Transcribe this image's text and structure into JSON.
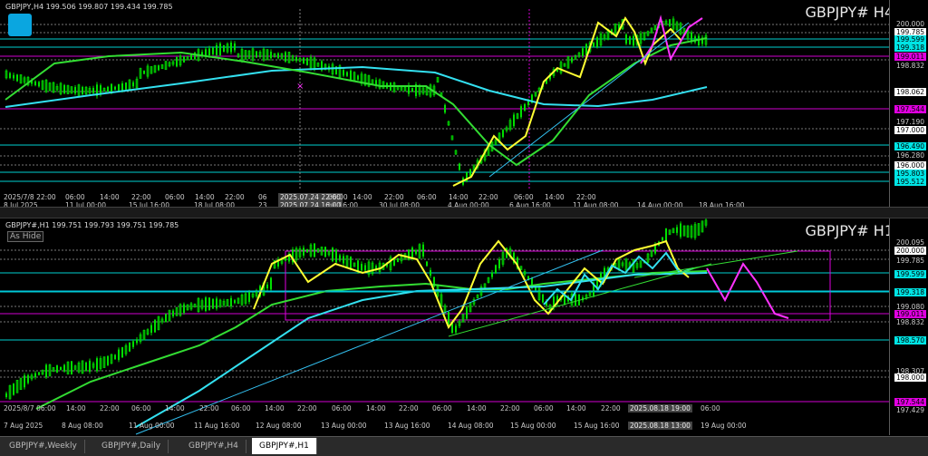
{
  "h4": {
    "header": "GBPJPY,H4  199.506 199.807 199.434 199.785",
    "symbol": "GBPJPY# H4",
    "price_labels": [
      {
        "text": "200.000",
        "style": "w"
      },
      {
        "text": "199.785",
        "style": "b"
      },
      {
        "text": "199.599",
        "style": "c"
      },
      {
        "text": "199.318",
        "style": "c"
      },
      {
        "text": "199.011",
        "style": "m"
      },
      {
        "text": "198.832",
        "style": "w"
      },
      {
        "text": "198.062",
        "style": "b"
      },
      {
        "text": "197.544",
        "style": "m"
      },
      {
        "text": "197.190",
        "style": "w"
      },
      {
        "text": "197.000",
        "style": "b"
      },
      {
        "text": "196.490",
        "style": "c"
      },
      {
        "text": "196.280",
        "style": "w"
      },
      {
        "text": "196.000",
        "style": "b"
      },
      {
        "text": "195.803",
        "style": "c"
      },
      {
        "text": "195.512",
        "style": "c"
      }
    ],
    "time_labels": [
      {
        "text": "2025/7/8 22:00",
        "style": ""
      },
      {
        "text": "06:00",
        "style": ""
      },
      {
        "text": "14:00",
        "style": ""
      },
      {
        "text": "22:00",
        "style": ""
      },
      {
        "text": "06:00",
        "style": ""
      },
      {
        "text": "14:00",
        "style": ""
      },
      {
        "text": "22:00",
        "style": ""
      },
      {
        "text": "06",
        "style": ""
      },
      {
        "text": "2025.07.24 22:00",
        "style": "hl"
      },
      {
        "text": "06:00",
        "style": ""
      },
      {
        "text": "14:00",
        "style": ""
      },
      {
        "text": "22:00",
        "style": ""
      },
      {
        "text": "06:00",
        "style": ""
      },
      {
        "text": "14:00",
        "style": ""
      },
      {
        "text": "22:00",
        "style": ""
      },
      {
        "text": "06:00",
        "style": ""
      },
      {
        "text": "14:00",
        "style": ""
      },
      {
        "text": "22:00",
        "style": ""
      }
    ],
    "date_labels": [
      {
        "text": "8 Jul 2025",
        "style": ""
      },
      {
        "text": "11 Jul 00:00",
        "style": ""
      },
      {
        "text": "15 Jul 16:00",
        "style": ""
      },
      {
        "text": "18 Jul 08:00",
        "style": ""
      },
      {
        "text": "23",
        "style": ""
      },
      {
        "text": "2025.07.24 16:00",
        "style": "hl"
      },
      {
        "text": "Jul 16:00",
        "style": ""
      },
      {
        "text": "30 Jul 08:00",
        "style": ""
      },
      {
        "text": "4 Aug 00:00",
        "style": ""
      },
      {
        "text": "6 Aug 16:00",
        "style": ""
      },
      {
        "text": "11 Aug 08:00",
        "style": ""
      },
      {
        "text": "14 Aug 00:00",
        "style": ""
      },
      {
        "text": "18 Aug 16:00",
        "style": ""
      }
    ]
  },
  "h1": {
    "header": "GBPJPY#,H1  199.751 199.793 199.751 199.785",
    "as_hide": "As Hide",
    "symbol": "GBPJPY# H1",
    "price_labels": [
      {
        "text": "200.095",
        "style": "w"
      },
      {
        "text": "200.000",
        "style": "b"
      },
      {
        "text": "199.785",
        "style": "w"
      },
      {
        "text": "199.599",
        "style": "c"
      },
      {
        "text": "199.318",
        "style": "c"
      },
      {
        "text": "199.080",
        "style": "w"
      },
      {
        "text": "199.011",
        "style": "m"
      },
      {
        "text": "198.832",
        "style": "w"
      },
      {
        "text": "198.570",
        "style": "c"
      },
      {
        "text": "198.307",
        "style": "w"
      },
      {
        "text": "198.000",
        "style": "b"
      },
      {
        "text": "197.544",
        "style": "m"
      },
      {
        "text": "197.429",
        "style": "w"
      }
    ],
    "time_labels": [
      {
        "text": "2025/8/7 06:00",
        "style": ""
      },
      {
        "text": "14:00",
        "style": ""
      },
      {
        "text": "22:00",
        "style": ""
      },
      {
        "text": "06:00",
        "style": ""
      },
      {
        "text": "14:00",
        "style": ""
      },
      {
        "text": "22:00",
        "style": ""
      },
      {
        "text": "06:00",
        "style": ""
      },
      {
        "text": "14:00",
        "style": ""
      },
      {
        "text": "22:00",
        "style": ""
      },
      {
        "text": "06:00",
        "style": ""
      },
      {
        "text": "14:00",
        "style": ""
      },
      {
        "text": "22:00",
        "style": ""
      },
      {
        "text": "06:00",
        "style": ""
      },
      {
        "text": "14:00",
        "style": ""
      },
      {
        "text": "22:00",
        "style": ""
      },
      {
        "text": "06:00",
        "style": ""
      },
      {
        "text": "14:00",
        "style": ""
      },
      {
        "text": "22:00",
        "style": ""
      },
      {
        "text": "06:00",
        "style": ""
      },
      {
        "text": "2025.08.18 19:00",
        "style": "hl"
      },
      {
        "text": "06:00",
        "style": ""
      }
    ],
    "date_labels": [
      {
        "text": "7 Aug 2025",
        "style": ""
      },
      {
        "text": "8 Aug 08:00",
        "style": ""
      },
      {
        "text": "11 Aug 00:00",
        "style": ""
      },
      {
        "text": "11 Aug 16:00",
        "style": ""
      },
      {
        "text": "12 Aug 08:00",
        "style": ""
      },
      {
        "text": "13 Aug 00:00",
        "style": ""
      },
      {
        "text": "13 Aug 16:00",
        "style": ""
      },
      {
        "text": "14 Aug 08:00",
        "style": ""
      },
      {
        "text": "15 Aug 00:00",
        "style": ""
      },
      {
        "text": "15 Aug 16:00",
        "style": ""
      },
      {
        "text": "2025.08.18 13:00",
        "style": "hl"
      },
      {
        "text": "19 Aug 00:00",
        "style": ""
      }
    ]
  },
  "tabs": [
    {
      "label": "GBPJPY#,Weekly",
      "active": false
    },
    {
      "label": "GBPJPY#,Daily",
      "active": false
    },
    {
      "label": "GBPJPY#,H4",
      "active": false
    },
    {
      "label": "GBPJPY#,H1",
      "active": true
    }
  ],
  "colors": {
    "candle": "#00e000",
    "ma_fast": "#ffff33",
    "ma_mid": "#33dd33",
    "ma_slow": "#33e0f0",
    "projection": "#ff33ff",
    "box": "#e000e0"
  }
}
